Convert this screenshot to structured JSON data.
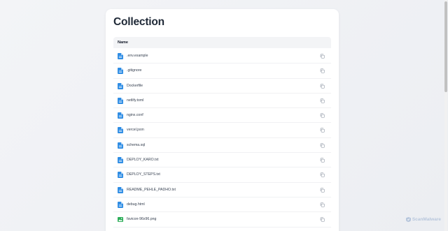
{
  "page": {
    "title": "Collection"
  },
  "table": {
    "header_name": "Name"
  },
  "files": [
    {
      "name": ".env.example",
      "icon": "document-icon"
    },
    {
      "name": ".gitignore",
      "icon": "document-icon"
    },
    {
      "name": "Dockerfile",
      "icon": "document-icon"
    },
    {
      "name": "netlify.toml",
      "icon": "document-icon"
    },
    {
      "name": "nginx.conf",
      "icon": "document-icon"
    },
    {
      "name": "vercel.json",
      "icon": "document-icon"
    },
    {
      "name": "schema.sql",
      "icon": "document-icon"
    },
    {
      "name": "DEPLOY_KARO.txt",
      "icon": "document-icon"
    },
    {
      "name": "DEPLOY_STEPS.txt",
      "icon": "document-icon"
    },
    {
      "name": "README_PEHLE_PADHO.txt",
      "icon": "document-icon"
    },
    {
      "name": "debug.html",
      "icon": "document-icon"
    },
    {
      "name": "favicon-96x96.png",
      "icon": "image-icon"
    }
  ],
  "watermark": {
    "text": "ScanMalware"
  },
  "colors": {
    "document_icon": "#2f8de4",
    "image_icon": "#2eae5a",
    "copy_icon": "#9ca3af",
    "title": "#1f2937"
  }
}
